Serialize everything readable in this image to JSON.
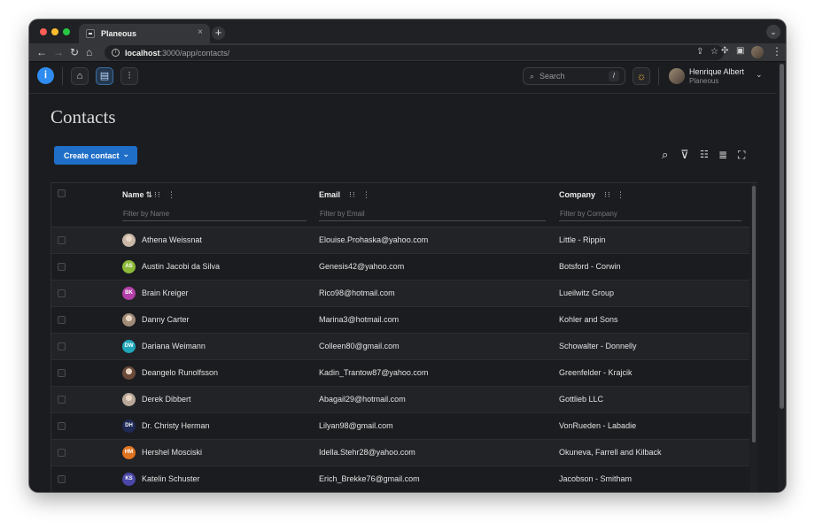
{
  "browser": {
    "tab_title": "Planeous",
    "tab_close": "×",
    "new_tab": "+",
    "url_host": "localhost",
    "url_path": ":3000/app/contacts/"
  },
  "header": {
    "logo": "Ꭵ",
    "search_placeholder": "Search",
    "search_shortcut": "/",
    "user_name": "Henrique Albert",
    "user_org": "Planeous"
  },
  "page": {
    "title": "Contacts",
    "create_label": "Create contact"
  },
  "table": {
    "columns": [
      {
        "label": "Name",
        "filter": "Filter by Name"
      },
      {
        "label": "Email",
        "filter": "Filter by Email"
      },
      {
        "label": "Company",
        "filter": "Filter by Company"
      }
    ],
    "rows": [
      {
        "initials": "",
        "color": "#c9b8a8",
        "photo": true,
        "name": "Athena Weissnat",
        "email": "Elouise.Prohaska@yahoo.com",
        "company": "Little - Rippin"
      },
      {
        "initials": "AS",
        "color": "#8db83a",
        "photo": false,
        "name": "Austin Jacobi da Silva",
        "email": "Genesis42@yahoo.com",
        "company": "Botsford - Corwin"
      },
      {
        "initials": "BK",
        "color": "#b23fa8",
        "photo": false,
        "name": "Brain Kreiger",
        "email": "Rico98@hotmail.com",
        "company": "Lueilwitz Group"
      },
      {
        "initials": "",
        "color": "#a08a78",
        "photo": true,
        "name": "Danny Carter",
        "email": "Marina3@hotmail.com",
        "company": "Kohler and Sons"
      },
      {
        "initials": "DW",
        "color": "#1fa6b8",
        "photo": false,
        "name": "Dariana Weimann",
        "email": "Colleen80@gmail.com",
        "company": "Schowalter - Donnelly"
      },
      {
        "initials": "",
        "color": "#6b4a3a",
        "photo": true,
        "name": "Deangelo Runolfsson",
        "email": "Kadin_Trantow87@yahoo.com",
        "company": "Greenfelder - Krajcik"
      },
      {
        "initials": "",
        "color": "#b8a898",
        "photo": true,
        "name": "Derek Dibbert",
        "email": "Abagail29@hotmail.com",
        "company": "Gottlieb LLC"
      },
      {
        "initials": "DH",
        "color": "#1f2a55",
        "photo": false,
        "name": "Dr. Christy Herman",
        "email": "Lilyan98@gmail.com",
        "company": "VonRueden - Labadie"
      },
      {
        "initials": "HM",
        "color": "#e0731f",
        "photo": false,
        "name": "Hershel Mosciski",
        "email": "Idella.Stehr28@yahoo.com",
        "company": "Okuneva, Farrell and Kilback"
      },
      {
        "initials": "KS",
        "color": "#4a47a8",
        "photo": false,
        "name": "Katelin Schuster",
        "email": "Erich_Brekke76@gmail.com",
        "company": "Jacobson - Smitham"
      }
    ]
  }
}
